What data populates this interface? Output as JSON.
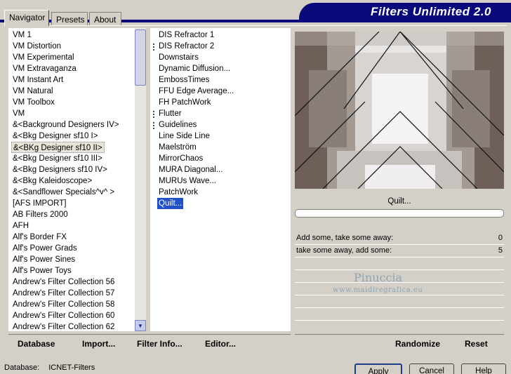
{
  "app": {
    "title": "Filters Unlimited 2.0"
  },
  "tabs": [
    {
      "label": "Navigator",
      "active": true
    },
    {
      "label": "Presets",
      "active": false
    },
    {
      "label": "About",
      "active": false
    }
  ],
  "categories": [
    "VM 1",
    "VM Distortion",
    "VM Experimental",
    "VM Extravaganza",
    "VM Instant Art",
    "VM Natural",
    "VM Toolbox",
    "VM",
    "&<Background Designers IV>",
    "&<Bkg Designer sf10 I>",
    "&<BKg Designer sf10 II>",
    "&<Bkg Designer sf10 III>",
    "&<Bkg Designers sf10 IV>",
    "&<Bkg Kaleidoscope>",
    "&<Sandflower Specials^v^ >",
    "[AFS IMPORT]",
    "AB Filters 2000",
    "AFH",
    "Alf's Border FX",
    "Alf's Power Grads",
    "Alf's Power Sines",
    "Alf's Power Toys",
    "Andrew's Filter Collection 56",
    "Andrew's Filter Collection 57",
    "Andrew's Filter Collection 58",
    "Andrew's Filter Collection 60",
    "Andrew's Filter Collection 62"
  ],
  "selected_category_index": 10,
  "filters": [
    {
      "label": "DIS Refractor 1",
      "mark": false
    },
    {
      "label": "DIS Refractor 2",
      "mark": true
    },
    {
      "label": "Downstairs",
      "mark": false
    },
    {
      "label": "Dynamic Diffusion...",
      "mark": false
    },
    {
      "label": "EmbossTimes",
      "mark": false
    },
    {
      "label": "FFU Edge Average...",
      "mark": false
    },
    {
      "label": "FH PatchWork",
      "mark": false
    },
    {
      "label": "Flutter",
      "mark": true
    },
    {
      "label": "Guidelines",
      "mark": true
    },
    {
      "label": "Line Side Line",
      "mark": false
    },
    {
      "label": "Maelström",
      "mark": false
    },
    {
      "label": "MirrorChaos",
      "mark": false
    },
    {
      "label": "MURA Diagonal...",
      "mark": false
    },
    {
      "label": "MURUs Wave...",
      "mark": false
    },
    {
      "label": "PatchWork",
      "mark": false
    },
    {
      "label": "Quilt...",
      "mark": false
    }
  ],
  "selected_filter_index": 15,
  "preview": {
    "filter_name": "Quilt...",
    "progress": 0
  },
  "params": [
    {
      "label": "Add some, take some away:",
      "value": "0"
    },
    {
      "label": "take some away, add some:",
      "value": "5"
    }
  ],
  "watermark": {
    "name": "Pinuccia",
    "url": "www.maidiregrafica.eu"
  },
  "toolbar": {
    "database": "Database",
    "import": "Import...",
    "filter_info": "Filter Info...",
    "editor": "Editor...",
    "randomize": "Randomize",
    "reset": "Reset"
  },
  "status": {
    "database_label": "Database:",
    "database_value": "ICNET-Filters"
  },
  "buttons": {
    "apply": "Apply",
    "cancel": "Cancel",
    "help": "Help"
  },
  "colors": {
    "banner": "#0a0a7a",
    "selection": "#2251c7"
  }
}
